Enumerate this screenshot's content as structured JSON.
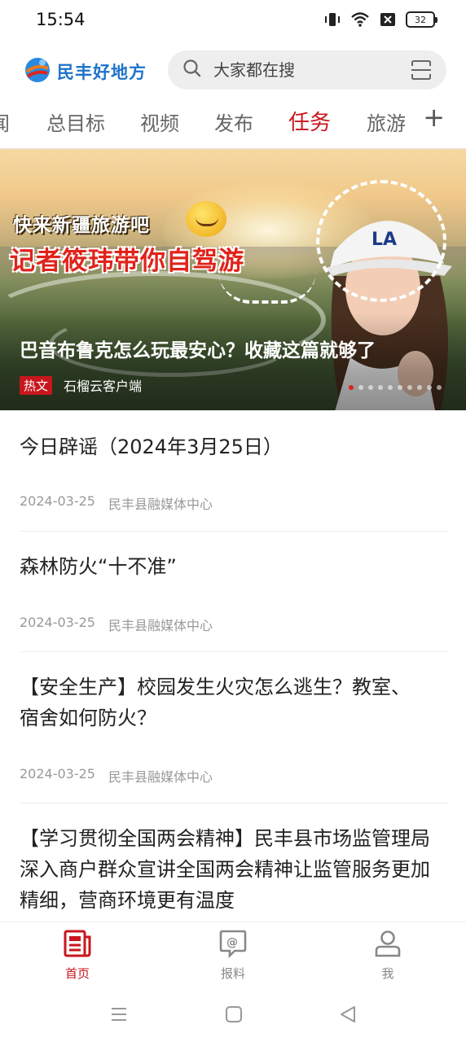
{
  "status_bar": {
    "time": "15:54",
    "battery": "32",
    "icons": [
      "vibrate-icon",
      "wifi-icon",
      "sim-off-icon",
      "battery-icon"
    ]
  },
  "header": {
    "app_name": "民丰好地方",
    "search_placeholder": "大家都在搜",
    "brand_color": "#1e73c8"
  },
  "tabs": {
    "items": [
      {
        "label": "闻"
      },
      {
        "label": "总目标"
      },
      {
        "label": "视频"
      },
      {
        "label": "发布"
      },
      {
        "label": "任务"
      },
      {
        "label": "旅游"
      }
    ],
    "active_index": 4,
    "plus_label": "+",
    "active_color": "#c8161d"
  },
  "banner": {
    "overlay_line1": "快来新疆旅游吧",
    "overlay_line2": "记者筱玮带你自驾游",
    "title": "巴音布鲁克怎么玩最安心？收藏这篇就够了",
    "tag": "热文",
    "source": "石榴云客户端",
    "slide_count": 10,
    "active_slide": 0
  },
  "news": [
    {
      "title": "今日辟谣（2024年3月25日）",
      "date": "2024-03-25",
      "source": "民丰县融媒体中心"
    },
    {
      "title": "森林防火“十不准”",
      "date": "2024-03-25",
      "source": "民丰县融媒体中心"
    },
    {
      "title": "【安全生产】校园发生火灾怎么逃生？教室、宿舍如何防火？",
      "date": "2024-03-25",
      "source": "民丰县融媒体中心"
    },
    {
      "title": "【学习贯彻全国两会精神】民丰县市场监管理局深入商户群众宣讲全国两会精神让监管服务更加精细，营商环境更有温度"
    }
  ],
  "bottom_nav": {
    "items": [
      {
        "label": "首页",
        "icon": "news-icon"
      },
      {
        "label": "报料",
        "icon": "report-chat-icon"
      },
      {
        "label": "我",
        "icon": "user-icon"
      }
    ],
    "active_index": 0
  }
}
